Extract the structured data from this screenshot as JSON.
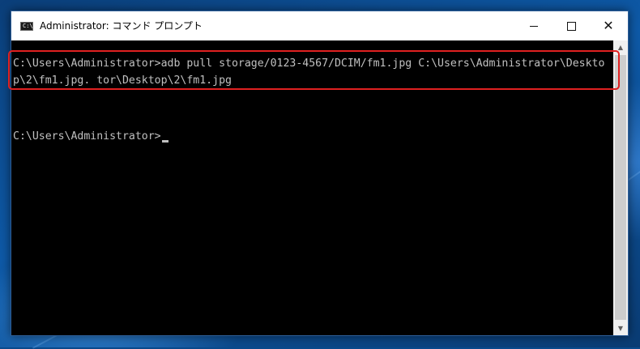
{
  "window": {
    "icon_text": "C:\\",
    "title": "Administrator: コマンド プロンプト",
    "controls": {
      "minimize": "",
      "maximize": "",
      "close": "✕"
    }
  },
  "console": {
    "lines": [
      "C:\\Users\\Administrator>adb pull storage/0123-4567/DCIM/fm1.jpg C:\\Users\\Administrator\\Deskto",
      "p\\2\\fm1.jpg. tor\\Desktop\\2\\fm1.jpg",
      "",
      "",
      "C:\\Users\\Administrator>"
    ]
  },
  "colors": {
    "console_bg": "#000000",
    "console_text": "#c0c0c0",
    "highlight_border": "#e02020",
    "desktop_bg": "#0e5aa8"
  },
  "icons": {
    "app": "cmd-icon",
    "minimize": "minimize-icon",
    "maximize": "maximize-icon",
    "close": "close-icon",
    "scroll_up": "chevron-up-icon",
    "scroll_down": "chevron-down-icon"
  }
}
